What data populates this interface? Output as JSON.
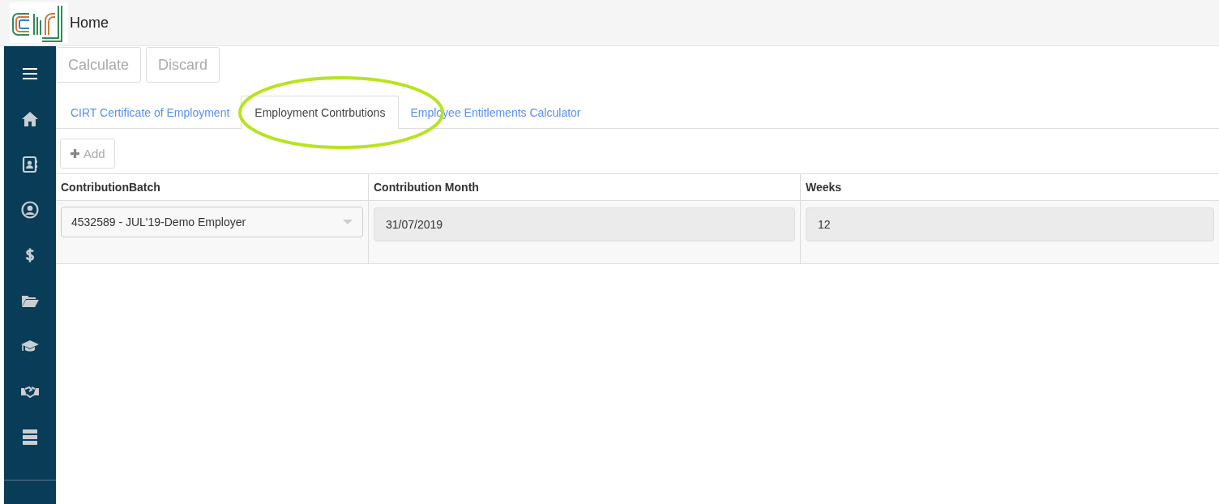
{
  "header": {
    "title": "Home"
  },
  "toolbar": {
    "buttons": [
      {
        "label": "Calculate",
        "disabled": true
      },
      {
        "label": "Discard",
        "disabled": true
      }
    ]
  },
  "tabs": [
    {
      "label": "CIRT Certificate of Employment",
      "selected": false
    },
    {
      "label": "Employment Contrbutions",
      "selected": true
    },
    {
      "label": "Employee Entitlements Calculator",
      "selected": false
    }
  ],
  "add_button": {
    "label": "Add",
    "disabled": true
  },
  "table": {
    "columns": [
      "ContributionBatch",
      "Contribution Month",
      "Weeks"
    ],
    "rows": [
      [
        {
          "kind": "select",
          "value": "4532589 - JUL'19-Demo Employer"
        },
        {
          "kind": "readonly",
          "value": "31/07/2019"
        },
        {
          "kind": "readonly",
          "value": "12"
        }
      ]
    ]
  }
}
